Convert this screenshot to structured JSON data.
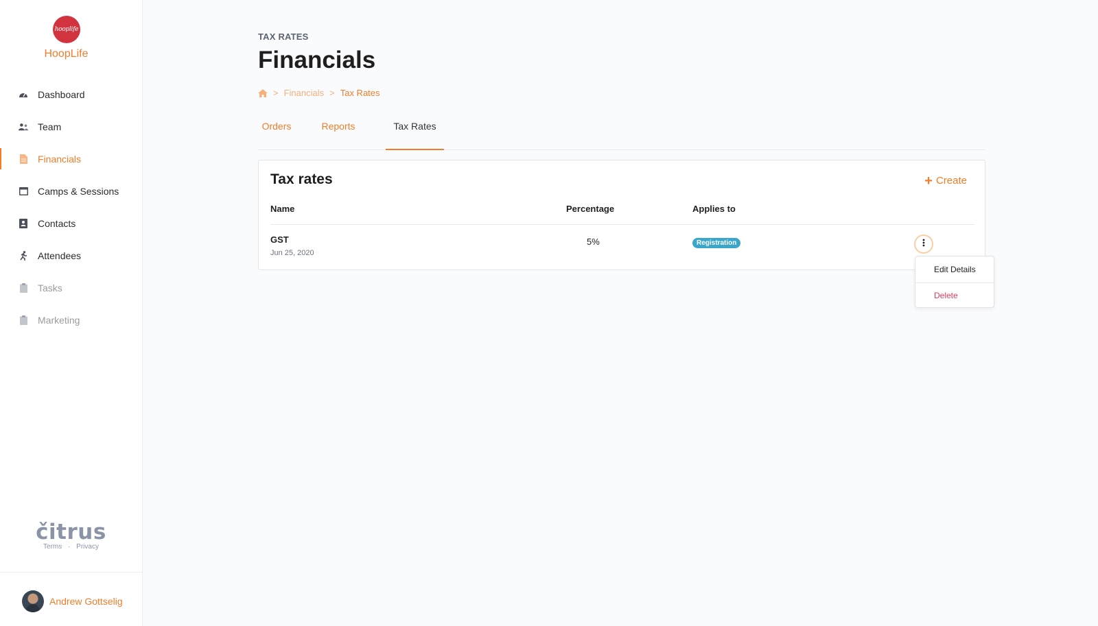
{
  "brand": {
    "logo_text": "hooplife",
    "name": "HoopLife"
  },
  "sidebar": {
    "items": [
      {
        "label": "Dashboard",
        "icon": "speedometer-icon",
        "state": "normal"
      },
      {
        "label": "Team",
        "icon": "people-icon",
        "state": "normal"
      },
      {
        "label": "Financials",
        "icon": "document-icon",
        "state": "active"
      },
      {
        "label": "Camps & Sessions",
        "icon": "calendar-icon",
        "state": "normal"
      },
      {
        "label": "Contacts",
        "icon": "address-book-icon",
        "state": "normal"
      },
      {
        "label": "Attendees",
        "icon": "running-person-icon",
        "state": "normal"
      },
      {
        "label": "Tasks",
        "icon": "clipboard-icon",
        "state": "disabled"
      },
      {
        "label": "Marketing",
        "icon": "clipboard-icon",
        "state": "disabled"
      }
    ]
  },
  "footer": {
    "logo": "čitrus",
    "terms": "Terms",
    "separator": "·",
    "privacy": "Privacy"
  },
  "user": {
    "name": "Andrew Gottselig"
  },
  "page": {
    "eyebrow": "TAX RATES",
    "title": "Financials"
  },
  "breadcrumb": {
    "separator": ">",
    "items": [
      "Financials",
      "Tax Rates"
    ]
  },
  "tabs": [
    "Orders",
    "Reports",
    "Tax Rates"
  ],
  "card": {
    "title": "Tax rates",
    "create_label": "Create",
    "columns": [
      "Name",
      "Percentage",
      "Applies to"
    ],
    "rows": [
      {
        "name": "GST",
        "date": "Jun 25, 2020",
        "percentage": "5%",
        "applies_to": "Registration"
      }
    ]
  },
  "row_menu": {
    "items": [
      "Edit Details",
      "Delete"
    ]
  },
  "colors": {
    "accent": "#f07d2a",
    "badge": "#3aa6c9",
    "danger": "#e23b5b",
    "logo_red": "#d2343f"
  }
}
